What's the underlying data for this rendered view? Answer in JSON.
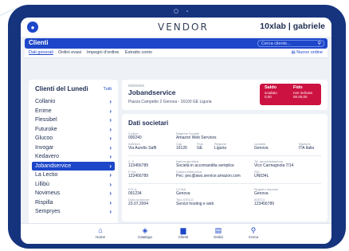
{
  "app": {
    "brand": "VENDOR",
    "company": "10xlab | gabriele"
  },
  "header": {
    "title": "Clienti",
    "search_placeholder": "Cerca cliente..."
  },
  "tabs": [
    {
      "label": "Dati generali",
      "active": true
    },
    {
      "label": "Ordini evasi",
      "active": false
    },
    {
      "label": "Impegni d'ordine",
      "active": false
    },
    {
      "label": "Estratto conto",
      "active": false
    }
  ],
  "new_order_label": "Nuovo ordine",
  "client_list": {
    "title": "Clienti del Lunedì",
    "link": "Tutti",
    "items": [
      {
        "label": "Collanio",
        "selected": false
      },
      {
        "label": "Errime",
        "selected": false
      },
      {
        "label": "Flessibel",
        "selected": false
      },
      {
        "label": "Futuroke",
        "selected": false
      },
      {
        "label": "Glucoo",
        "selected": false
      },
      {
        "label": "Invogar",
        "selected": false
      },
      {
        "label": "Kedavero",
        "selected": false
      },
      {
        "label": "Jobandservice",
        "selected": true
      },
      {
        "label": "La Lectio",
        "selected": false
      },
      {
        "label": "Lillibù",
        "selected": false
      },
      {
        "label": "Novimeus",
        "selected": false
      },
      {
        "label": "Rispilla",
        "selected": false
      },
      {
        "label": "Sempryes",
        "selected": false
      }
    ]
  },
  "client": {
    "code": "00000000",
    "name": "Jobandservice",
    "address": "Piazza Campetto 2 Genova - 16100 GE Liguria",
    "saldo_label": "Saldo",
    "saldo_status": "scaduto",
    "saldo_value": "0,00",
    "fido_label": "Fido",
    "fido_status": "non indicato",
    "fido_value": "00.00,00"
  },
  "dati": {
    "title": "Dati societari",
    "codice_label": "Codice",
    "codice": "000240",
    "ragione_label": "Ragione Sociale",
    "ragione": "Amazon Web Services",
    "indirizzo_label": "Indirizzo",
    "indirizzo": "Via Aurelio Saffi",
    "cap_label": "Cap",
    "cap": "16126",
    "prov_label": "Prov",
    "prov": "GE",
    "regione_label": "Regione",
    "regione": "Liguria",
    "localita_label": "Località",
    "localita": "Genova",
    "nazione_label": "Nazione",
    "nazione": "ITA Italia",
    "cf_label": "C. F.",
    "cf": "123456789",
    "natura_label": "Natura giuridica",
    "natura": "Società in accomandita semplice",
    "sede_label": "Sit. amministrazione",
    "sede": "Vico Carmagnola 7/14",
    "piva_label": "P. iva",
    "piva": "123456789",
    "fattura_label": "Fattura elettronica",
    "fattura": "Pec: pec@aws.service.amazon.com",
    "sdi_label": "SDI",
    "sdi": "UN034L",
    "rea_label": "R.E.A.",
    "rea": "091234",
    "cciaa_label": "CCIAA",
    "cciaa": "Genova",
    "registro_label": "Registro imprese",
    "registro": "Genova",
    "costituzione_label": "Data iscrizione",
    "costituzione": "23.07.2004",
    "ateco_label": "Tipo ATECO",
    "ateco": "Servizi hosting e web",
    "ateco_code_label": "ATECO",
    "ateco_code": "123456789"
  },
  "bottom_nav": [
    {
      "label": "Home",
      "icon": "home-icon",
      "glyph": "⌂"
    },
    {
      "label": "Catalogo",
      "icon": "catalog-icon",
      "glyph": "◈"
    },
    {
      "label": "Clienti",
      "icon": "clients-icon",
      "glyph": "▆"
    },
    {
      "label": "Ordini",
      "icon": "orders-icon",
      "glyph": "▤"
    },
    {
      "label": "Cerca",
      "icon": "search-icon",
      "glyph": "⚲"
    }
  ],
  "colors": {
    "accent": "#1d46c9",
    "frame": "#16337d",
    "alert": "#cc1241"
  }
}
